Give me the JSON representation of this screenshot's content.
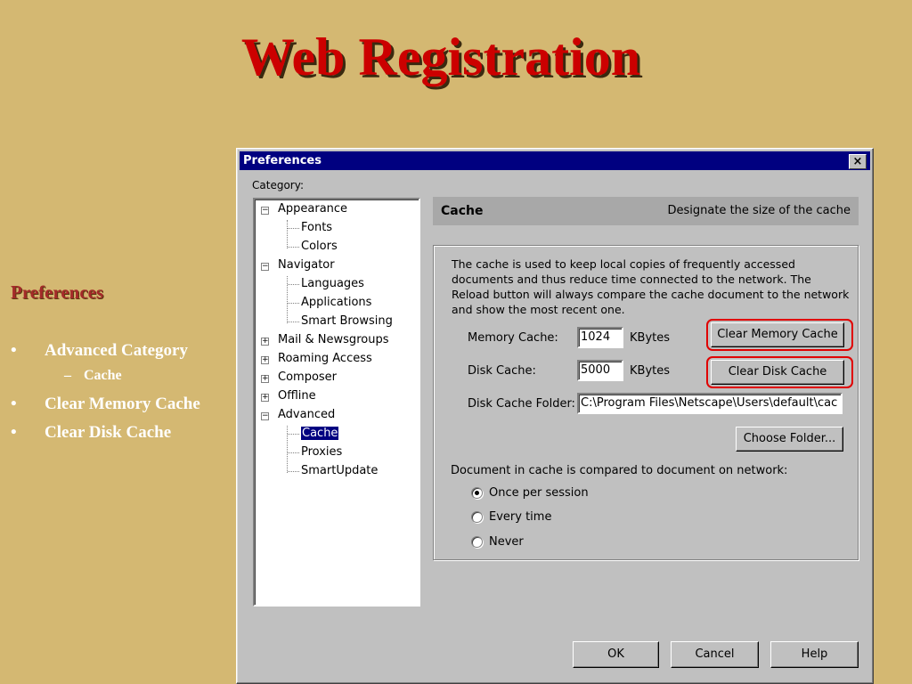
{
  "slide": {
    "title": "Web Registration",
    "section_heading": "Preferences",
    "bullets": [
      {
        "label": "Advanced Category",
        "marker": "•"
      },
      {
        "label": "Clear Memory Cache",
        "marker": "•"
      },
      {
        "label": "Clear Disk Cache",
        "marker": "•"
      }
    ],
    "sub_bullet": {
      "label": "Cache",
      "marker": "–"
    }
  },
  "dialog": {
    "title": "Preferences",
    "close_glyph": "×",
    "category_label": "Category:",
    "tree": [
      {
        "label": "Appearance",
        "expander": "−"
      },
      {
        "label": "Fonts"
      },
      {
        "label": "Colors"
      },
      {
        "label": "Navigator",
        "expander": "−"
      },
      {
        "label": "Languages"
      },
      {
        "label": "Applications"
      },
      {
        "label": "Smart Browsing"
      },
      {
        "label": "Mail & Newsgroups",
        "expander": "+"
      },
      {
        "label": "Roaming Access",
        "expander": "+"
      },
      {
        "label": "Composer",
        "expander": "+"
      },
      {
        "label": "Offline",
        "expander": "+"
      },
      {
        "label": "Advanced",
        "expander": "−"
      },
      {
        "label": "Cache",
        "selected": true
      },
      {
        "label": "Proxies"
      },
      {
        "label": "SmartUpdate"
      }
    ],
    "panel": {
      "title": "Cache",
      "description": "Designate the size of the cache",
      "info_text": "The cache is used to keep local copies of frequently accessed documents and thus reduce time connected to the network. The Reload button will always compare the cache document to the network and show the most recent one.",
      "memory_cache_label": "Memory Cache:",
      "memory_cache_value": "1024",
      "memory_unit": "KBytes",
      "clear_memory_button": "Clear Memory Cache",
      "disk_cache_label": "Disk Cache:",
      "disk_cache_value": "5000",
      "disk_unit": "KBytes",
      "clear_disk_button": "Clear Disk Cache",
      "folder_label": "Disk Cache Folder:",
      "folder_value": "C:\\Program Files\\Netscape\\Users\\default\\cac",
      "choose_folder_button": "Choose Folder...",
      "compare_label": "Document in cache is compared to document on network:",
      "radio_options": [
        {
          "label": "Once per session",
          "checked": true
        },
        {
          "label": "Every time",
          "checked": false
        },
        {
          "label": "Never",
          "checked": false
        }
      ]
    },
    "buttons": {
      "ok": "OK",
      "cancel": "Cancel",
      "help": "Help"
    },
    "highlight_color": "#e00000"
  }
}
